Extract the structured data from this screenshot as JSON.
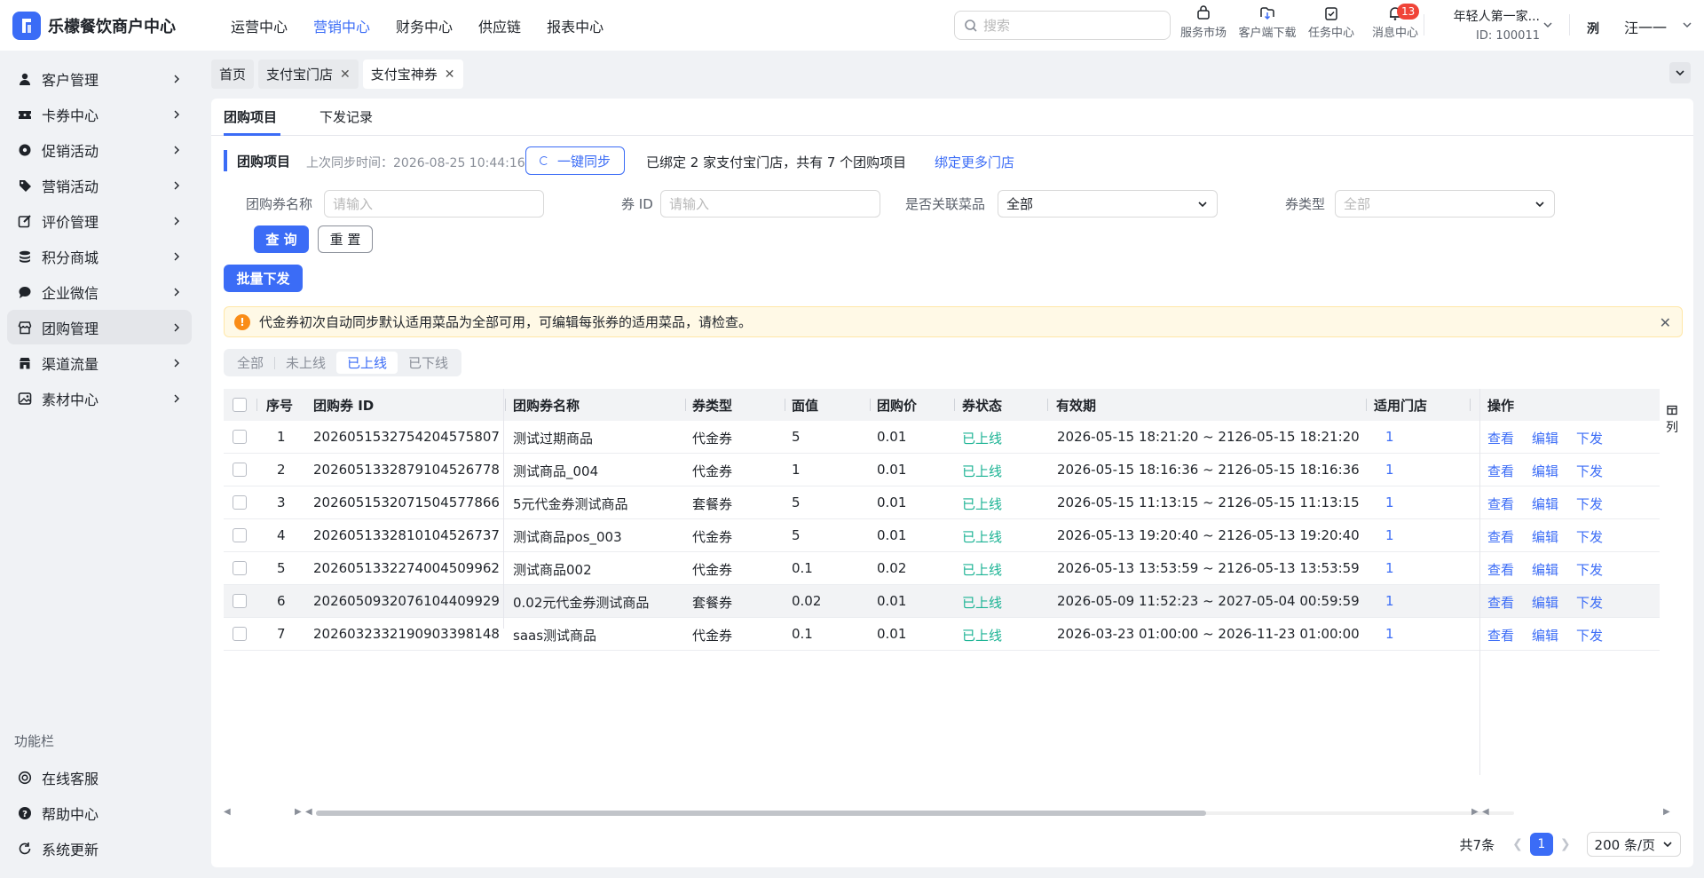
{
  "app": {
    "title": "乐檬餐饮商户中心"
  },
  "topnav": [
    "运营中心",
    "营销中心",
    "财务中心",
    "供应链",
    "报表中心"
  ],
  "topnav_active": 1,
  "search": {
    "placeholder": "搜索"
  },
  "tools": [
    {
      "label": "服务市场",
      "icon": "store-icon"
    },
    {
      "label": "客户端下载",
      "icon": "cloud-download-icon"
    },
    {
      "label": "任务中心",
      "icon": "task-icon"
    },
    {
      "label": "消息中心",
      "icon": "bell-icon",
      "badge": "13"
    }
  ],
  "org": {
    "name": "年轻人第一家...",
    "id": "ID: 100011"
  },
  "user": {
    "avatar_text": "洌",
    "name": "汪一一"
  },
  "sidebar": {
    "items": [
      {
        "label": "客户管理",
        "icon": "user-icon"
      },
      {
        "label": "卡券中心",
        "icon": "ticket-icon"
      },
      {
        "label": "促销活动",
        "icon": "gear-badge-icon"
      },
      {
        "label": "营销活动",
        "icon": "tag-icon"
      },
      {
        "label": "评价管理",
        "icon": "edit-icon"
      },
      {
        "label": "积分商城",
        "icon": "coins-icon"
      },
      {
        "label": "企业微信",
        "icon": "chat-icon"
      },
      {
        "label": "团购管理",
        "icon": "shop-icon"
      },
      {
        "label": "渠道流量",
        "icon": "channel-icon"
      },
      {
        "label": "素材中心",
        "icon": "image-icon"
      }
    ],
    "active": 7,
    "func_title": "功能栏",
    "func_items": [
      {
        "label": "在线客服",
        "icon": "headset-icon"
      },
      {
        "label": "帮助中心",
        "icon": "help-icon"
      },
      {
        "label": "系统更新",
        "icon": "refresh-icon"
      }
    ]
  },
  "page_tabs": [
    {
      "label": "首页",
      "closable": false
    },
    {
      "label": "支付宝门店",
      "closable": true
    },
    {
      "label": "支付宝神券",
      "closable": true
    }
  ],
  "sub_tabs": [
    "团购项目",
    "下发记录"
  ],
  "section": {
    "title": "团购项目",
    "sync_time": "上次同步时间：2026-08-25 10:44:16",
    "sync_button": "一键同步",
    "bind_info": "已绑定 2 家支付宝门店，共有 7 个团购项目",
    "bind_link": "绑定更多门店"
  },
  "filters": {
    "name_label": "团购券名称",
    "name_placeholder": "请输入",
    "id_label": "券 ID",
    "id_placeholder": "请输入",
    "dish_label": "是否关联菜品",
    "dish_value": "全部",
    "type_label": "券类型",
    "type_placeholder": "全部",
    "query_button": "查 询",
    "reset_button": "重 置"
  },
  "batch_button": "批量下发",
  "alert": {
    "text": "代金券初次自动同步默认适用菜品为全部可用，可编辑每张券的适用菜品，请检查。"
  },
  "status_tabs": [
    "全部",
    "未上线",
    "已上线",
    "已下线"
  ],
  "status_active": 2,
  "table": {
    "columns": [
      "序号",
      "团购券 ID",
      "团购券名称",
      "券类型",
      "面值",
      "团购价",
      "券状态",
      "有效期",
      "适用门店",
      "操作"
    ],
    "column_setting": "列",
    "actions": [
      "查看",
      "编辑",
      "下发"
    ],
    "rows": [
      {
        "no": "1",
        "id": "2026051532754204575807",
        "name": "测试过期商品",
        "type": "代金券",
        "face": "5",
        "price": "0.01",
        "status": "已上线",
        "period": "2026-05-15 18:21:20 ~ 2126-05-15 18:21:20",
        "stores": "1"
      },
      {
        "no": "2",
        "id": "2026051332879104526778",
        "name": "测试商品_004",
        "type": "代金券",
        "face": "1",
        "price": "0.01",
        "status": "已上线",
        "period": "2026-05-15 18:16:36 ~ 2126-05-15 18:16:36",
        "stores": "1"
      },
      {
        "no": "3",
        "id": "2026051532071504577866",
        "name": "5元代金券测试商品",
        "type": "套餐券",
        "face": "5",
        "price": "0.01",
        "status": "已上线",
        "period": "2026-05-15 11:13:15 ~ 2126-05-15 11:13:15",
        "stores": "1"
      },
      {
        "no": "4",
        "id": "2026051332810104526737",
        "name": "测试商品pos_003",
        "type": "代金券",
        "face": "5",
        "price": "0.01",
        "status": "已上线",
        "period": "2026-05-13 19:20:40 ~ 2126-05-13 19:20:40",
        "stores": "1"
      },
      {
        "no": "5",
        "id": "2026051332274004509962",
        "name": "测试商品002",
        "type": "代金券",
        "face": "0.1",
        "price": "0.02",
        "status": "已上线",
        "period": "2026-05-13 13:53:59 ~ 2126-05-13 13:53:59",
        "stores": "1"
      },
      {
        "no": "6",
        "id": "2026050932076104409929",
        "name": "0.02元代金券测试商品",
        "type": "套餐券",
        "face": "0.02",
        "price": "0.01",
        "status": "已上线",
        "period": "2026-05-09 11:52:23 ~ 2027-05-04 00:59:59",
        "stores": "1"
      },
      {
        "no": "7",
        "id": "2026032332190903398148",
        "name": "saas测试商品",
        "type": "代金券",
        "face": "0.1",
        "price": "0.01",
        "status": "已上线",
        "period": "2026-03-23 01:00:00 ~ 2026-11-23 01:00:00",
        "stores": "1"
      }
    ]
  },
  "pagination": {
    "total": "共7条",
    "current": "1",
    "page_size": "200 条/页"
  },
  "colors": {
    "primary": "#3b6cf6",
    "status_online": "#1bb394",
    "alert_bg": "#fff9e6",
    "badge": "#f04438"
  }
}
